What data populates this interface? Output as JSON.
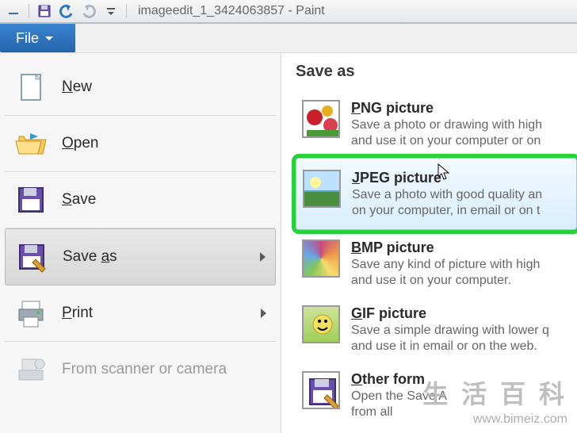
{
  "window": {
    "title": "imageedit_1_3424063857 - Paint"
  },
  "toolbar": {
    "minimize_tooltip": "Minimize",
    "save_tooltip": "Save",
    "undo_tooltip": "Undo",
    "redo_tooltip": "Redo",
    "customize_tooltip": "Customize"
  },
  "tabs": {
    "file": "File"
  },
  "file_menu": [
    {
      "label": "New",
      "u": 0,
      "icon": "new-file-icon",
      "expandable": false,
      "disabled": false
    },
    {
      "label": "Open",
      "u": 0,
      "icon": "open-folder-icon",
      "expandable": false,
      "disabled": false
    },
    {
      "label": "Save",
      "u": 0,
      "icon": "save-floppy-icon",
      "expandable": false,
      "disabled": false
    },
    {
      "label": "Save as",
      "u": 5,
      "icon": "save-as-icon",
      "expandable": true,
      "disabled": false,
      "active": true
    },
    {
      "label": "Print",
      "u": 0,
      "icon": "printer-icon",
      "expandable": true,
      "disabled": false
    },
    {
      "label": "From scanner or camera",
      "u": -1,
      "icon": "scanner-icon",
      "expandable": false,
      "disabled": true
    }
  ],
  "saveas_panel": {
    "heading": "Save as",
    "formats": [
      {
        "key": "png",
        "title": "PNG picture",
        "u": 0,
        "desc1": "Save a photo or drawing with high",
        "desc2": "and use it on your computer or on"
      },
      {
        "key": "jpeg",
        "title": "JPEG picture",
        "u": 0,
        "desc1": "Save a photo with good quality an",
        "desc2": "on your computer, in email or on t",
        "highlight": true
      },
      {
        "key": "bmp",
        "title": "BMP picture",
        "u": 0,
        "desc1": "Save any kind of picture with high",
        "desc2": "and use it on your computer."
      },
      {
        "key": "gif",
        "title": "GIF picture",
        "u": 0,
        "desc1": "Save a simple drawing with lower q",
        "desc2": "and use it in email or on the web."
      },
      {
        "key": "other",
        "title": "Other form",
        "u": 0,
        "desc1": "Open the Save A",
        "desc2": "from all"
      }
    ]
  },
  "watermark": {
    "main": "生 活 百 科",
    "sub": "www.bimeiz.com"
  }
}
